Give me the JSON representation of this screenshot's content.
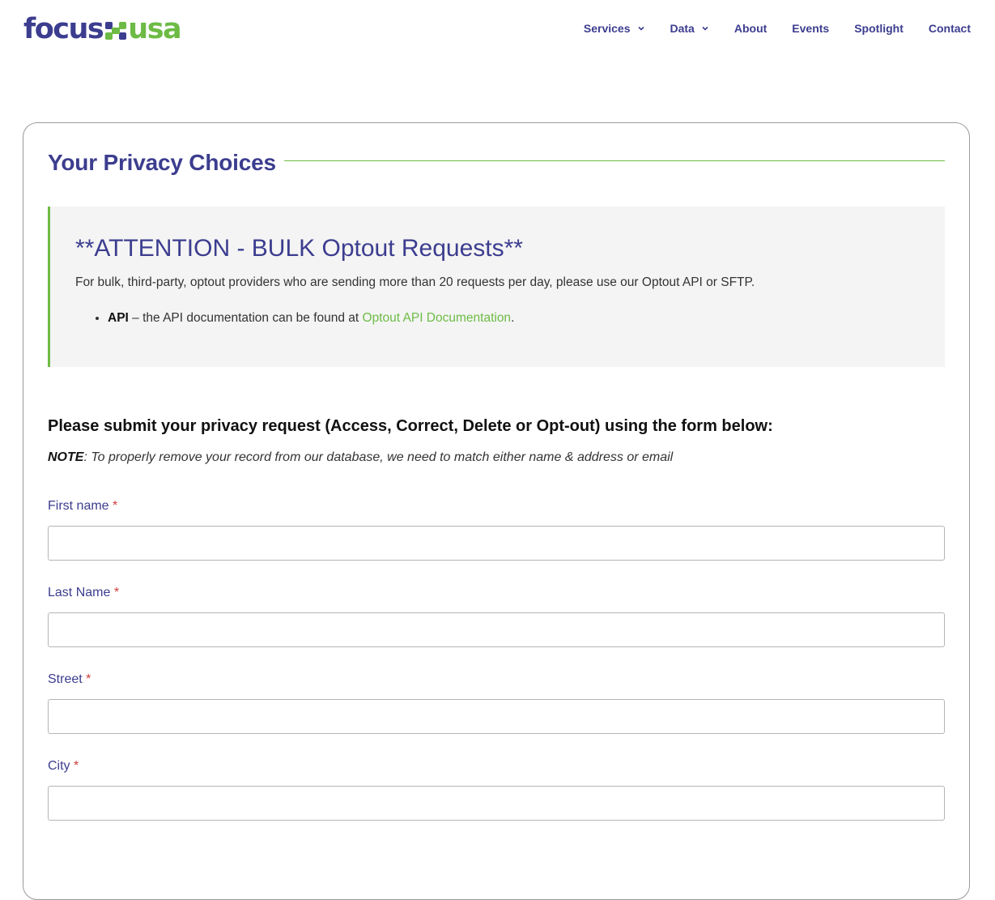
{
  "logo": {
    "part1": "focus",
    "part2": "usa",
    "colors": {
      "primary": "#3c3d8f",
      "accent": "#6dbb45"
    }
  },
  "nav": [
    {
      "label": "Services",
      "dropdown": true
    },
    {
      "label": "Data",
      "dropdown": true
    },
    {
      "label": "About",
      "dropdown": false
    },
    {
      "label": "Events",
      "dropdown": false
    },
    {
      "label": "Spotlight",
      "dropdown": false
    },
    {
      "label": "Contact",
      "dropdown": false
    }
  ],
  "page": {
    "title": "Your Privacy Choices"
  },
  "notice": {
    "title": "**ATTENTION - BULK Optout Requests**",
    "text": "For bulk, third-party, optout providers who are sending more than 20 requests per day, please use our Optout API or SFTP.",
    "item_strong": "API",
    "item_text": " – the API documentation can be found at ",
    "item_link": "Optout API Documentation",
    "item_end": "."
  },
  "form": {
    "heading": "Please submit your privacy request (Access, Correct, Delete or Opt-out) using the form below:",
    "note_label": "NOTE",
    "note_text": ": To properly remove your record from our database, we need to match either name & address or email",
    "required_marker": "*",
    "fields": [
      {
        "label": "First name",
        "value": ""
      },
      {
        "label": "Last Name",
        "value": ""
      },
      {
        "label": "Street",
        "value": ""
      },
      {
        "label": "City",
        "value": ""
      }
    ]
  }
}
